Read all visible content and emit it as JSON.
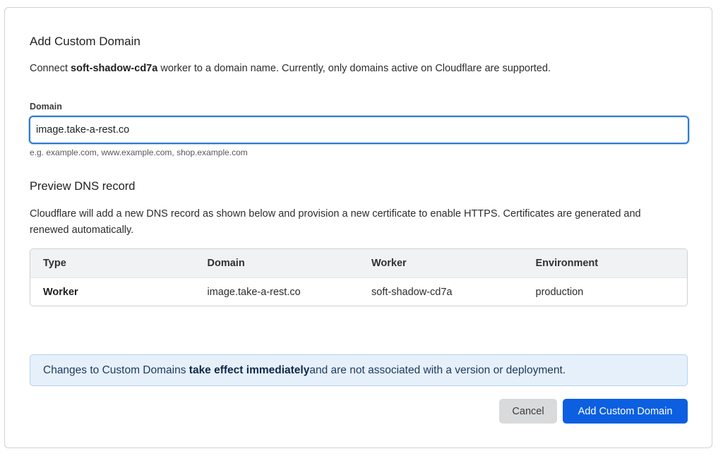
{
  "dialog": {
    "title": "Add Custom Domain",
    "description": {
      "prefix": "Connect ",
      "worker_name": "soft-shadow-cd7a",
      "suffix": " worker to a domain name. Currently, only domains active on Cloudflare are supported."
    }
  },
  "domain_field": {
    "label": "Domain",
    "value": "image.take-a-rest.co",
    "hint": "e.g. example.com, www.example.com, shop.example.com"
  },
  "preview": {
    "title": "Preview DNS record",
    "description": "Cloudflare will add a new DNS record as shown below and provision a new certificate to enable HTTPS. Certificates are generated and renewed automatically.",
    "columns": [
      "Type",
      "Domain",
      "Worker",
      "Environment"
    ],
    "rows": [
      [
        "Worker",
        "image.take-a-rest.co",
        "soft-shadow-cd7a",
        "production"
      ]
    ]
  },
  "notice": {
    "prefix": "Changes to Custom Domains ",
    "emphasis": "take effect immediately",
    "suffix": " and are not associated with a version or deployment."
  },
  "actions": {
    "cancel_label": "Cancel",
    "submit_label": "Add Custom Domain"
  },
  "colors": {
    "primary": "#0b5fe0",
    "focus_border": "#2f7bd4",
    "notice_bg": "#e6f0fb"
  }
}
